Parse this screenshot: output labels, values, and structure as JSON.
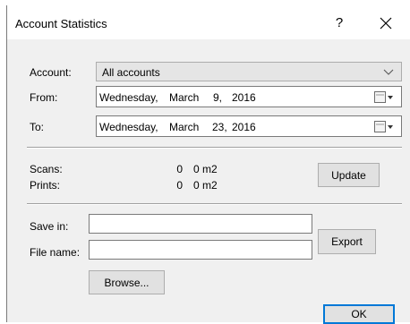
{
  "window": {
    "title": "Account Statistics",
    "help_glyph": "?",
    "close_glyph": "✕"
  },
  "account": {
    "label": "Account:",
    "value": "All accounts",
    "icon": "chevron-down-icon"
  },
  "from": {
    "label": "From:",
    "weekday": "Wednesday,",
    "month": "March",
    "day": "9,",
    "year": "2016",
    "icon": "calendar-dropdown-icon"
  },
  "to": {
    "label": "To:",
    "weekday": "Wednesday,",
    "month": "March",
    "day": "23,",
    "year": "2016",
    "icon": "calendar-dropdown-icon"
  },
  "stats": {
    "scans_label": "Scans:",
    "scans_count": "0",
    "scans_area": "0 m2",
    "prints_label": "Prints:",
    "prints_count": "0",
    "prints_area": "0 m2"
  },
  "buttons": {
    "update": "Update",
    "export": "Export",
    "browse": "Browse...",
    "ok": "OK"
  },
  "export_fields": {
    "save_in_label": "Save in:",
    "save_in_value": "",
    "file_name_label": "File name:",
    "file_name_value": ""
  },
  "colors": {
    "dialog_bg": "#f0f0f0",
    "titlebar_bg": "#ffffff",
    "default_button_border": "#0078d7"
  }
}
